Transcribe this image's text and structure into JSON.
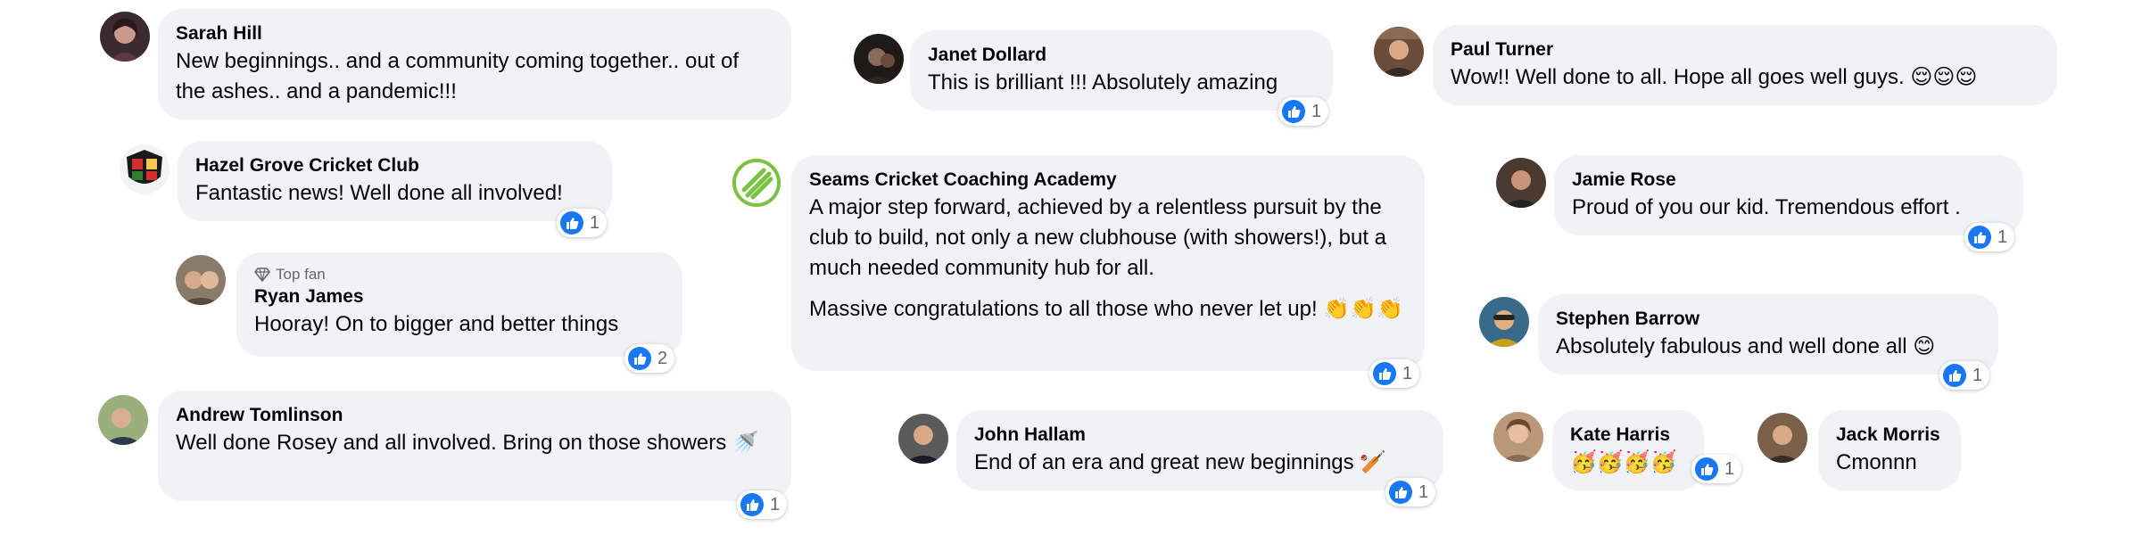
{
  "comments": [
    {
      "id": "sarah",
      "name": "Sarah Hill",
      "lines": [
        "New beginnings.. and a community coming together.. out of the ashes.. and a pandemic!!!"
      ]
    },
    {
      "id": "janet",
      "name": "Janet Dollard",
      "lines": [
        "This is brilliant !!! Absolutely amazing"
      ],
      "likes": "1"
    },
    {
      "id": "paul",
      "name": "Paul Turner",
      "lines": [
        "Wow!! Well done to all. Hope all goes well guys. 😌😌😌"
      ]
    },
    {
      "id": "hazel",
      "name": "Hazel Grove Cricket Club",
      "lines": [
        "Fantastic news! Well done all involved!"
      ],
      "likes": "1"
    },
    {
      "id": "seams",
      "name": "Seams Cricket Coaching Academy",
      "lines": [
        "A major step forward, achieved by a relentless pursuit by the club to build, not only a new clubhouse (with showers!), but a much needed community hub for all.",
        "Massive congratulations to all those who never let up! 👏👏👏"
      ],
      "likes": "1"
    },
    {
      "id": "jamie",
      "name": "Jamie Rose",
      "lines": [
        "Proud of you our kid. Tremendous effort ."
      ],
      "likes": "1"
    },
    {
      "id": "ryan",
      "name": "Ryan James",
      "badge": "Top fan",
      "lines": [
        "Hooray! On to bigger and better things"
      ],
      "likes": "2"
    },
    {
      "id": "stephen",
      "name": "Stephen Barrow",
      "lines": [
        "Absolutely fabulous and well done all 😊"
      ],
      "likes": "1"
    },
    {
      "id": "andrew",
      "name": "Andrew Tomlinson",
      "lines": [
        "Well done Rosey and all involved. Bring on those showers 🚿"
      ],
      "likes": "1"
    },
    {
      "id": "john",
      "name": "John Hallam",
      "lines": [
        "End of an era and great new beginnings 🏏"
      ],
      "likes": "1"
    },
    {
      "id": "kate",
      "name": "Kate Harris",
      "lines": [
        "🥳🥳🥳🥳"
      ],
      "likes": "1"
    },
    {
      "id": "jack",
      "name": "Jack Morris",
      "lines": [
        "Cmonnn"
      ]
    }
  ],
  "colors": {
    "bubble": "#f0f2f5",
    "like": "#1877f2",
    "meta": "#65676b"
  },
  "icons": {
    "like": "like-thumb-icon",
    "topfan": "diamond-icon"
  }
}
